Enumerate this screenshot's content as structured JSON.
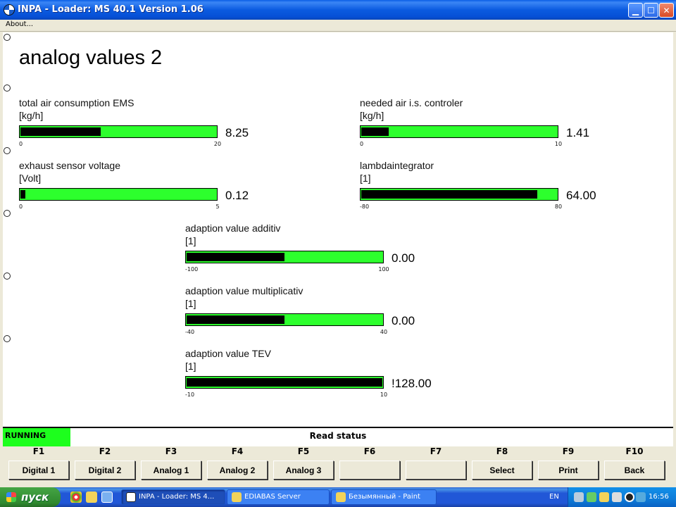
{
  "window": {
    "title": "INPA - Loader:  MS 40.1 Version 1.06",
    "menu_about": "About..."
  },
  "page_title": "analog values 2",
  "gauges": [
    {
      "label": "total air consumption EMS",
      "unit": "[kg/h]",
      "value": "8.25",
      "min": "0",
      "max": "20",
      "fill": 0.41
    },
    {
      "label": "needed air i.s. controler",
      "unit": "[kg/h]",
      "value": "1.41",
      "min": "0",
      "max": "10",
      "fill": 0.14
    },
    {
      "label": "exhaust sensor voltage",
      "unit": "[Volt]",
      "value": "0.12",
      "min": "0",
      "max": "5",
      "fill": 0.024
    },
    {
      "label": "lambdaintegrator",
      "unit": "[1]",
      "value": "64.00",
      "min": "-80",
      "max": "80",
      "fill": 0.9
    },
    {
      "label": "adaption value additiv",
      "unit": "[1]",
      "value": "0.00",
      "min": "-100",
      "max": "100",
      "fill": 0.5
    },
    {
      "label": "adaption value multiplicativ",
      "unit": "[1]",
      "value": "0.00",
      "min": "-40",
      "max": "40",
      "fill": 0.5
    },
    {
      "label": "adaption value TEV",
      "unit": "[1]",
      "value": "!128.00",
      "min": "-10",
      "max": "10",
      "fill": 1.0
    }
  ],
  "status": {
    "running": "RUNNING",
    "text": "Read status"
  },
  "fkeys": [
    {
      "key": "F1",
      "label": "Digital 1"
    },
    {
      "key": "F2",
      "label": "Digital 2"
    },
    {
      "key": "F3",
      "label": "Analog 1"
    },
    {
      "key": "F4",
      "label": "Analog 2"
    },
    {
      "key": "F5",
      "label": "Analog 3"
    },
    {
      "key": "F6",
      "label": ""
    },
    {
      "key": "F7",
      "label": ""
    },
    {
      "key": "F8",
      "label": "Select"
    },
    {
      "key": "F9",
      "label": "Print"
    },
    {
      "key": "F10",
      "label": "Back"
    }
  ],
  "taskbar": {
    "start": "пуск",
    "tasks": [
      {
        "label": "INPA - Loader:  MS 4...",
        "active": true,
        "icon": "inpa-icon"
      },
      {
        "label": "EDIABAS Server",
        "active": false,
        "icon": "ediabas-icon"
      },
      {
        "label": "Безымянный - Paint",
        "active": false,
        "icon": "paint-icon"
      }
    ],
    "lang": "EN",
    "clock": "16:56"
  }
}
